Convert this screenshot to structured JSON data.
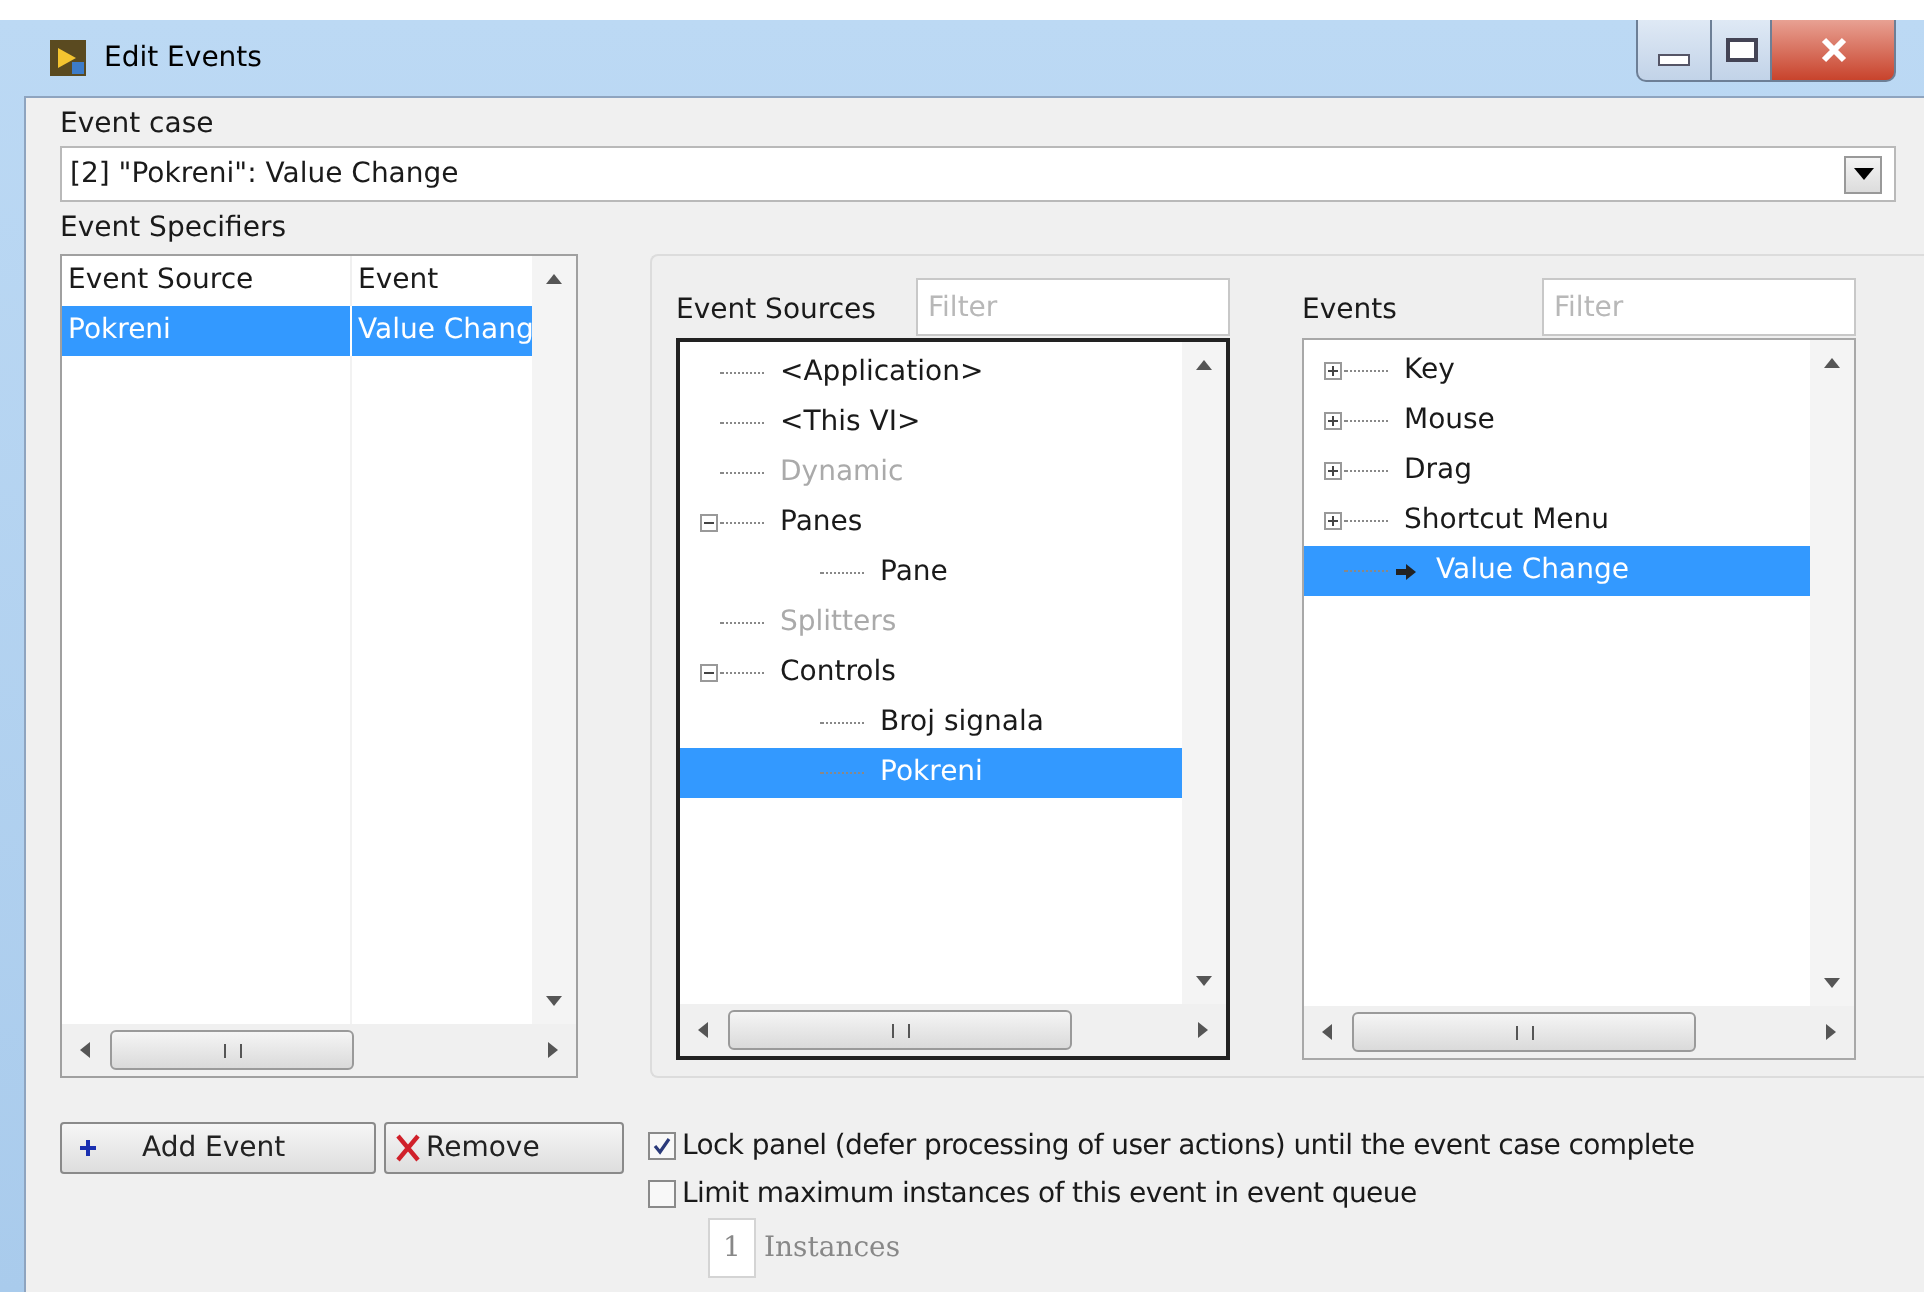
{
  "window": {
    "title": "Edit Events"
  },
  "event_case": {
    "label": "Event case",
    "value": "[2] \"Pokreni\": Value Change"
  },
  "event_specifiers": {
    "label": "Event Specifiers",
    "columns": [
      "Event Source",
      "Event"
    ],
    "rows": [
      {
        "cells": [
          "Pokreni",
          "Value Chang"
        ],
        "selected": true
      }
    ]
  },
  "event_sources": {
    "label": "Event Sources",
    "filter_placeholder": "Filter",
    "items": [
      {
        "label": "<Application>",
        "disabled": false,
        "selected": false
      },
      {
        "label": "<This VI>",
        "disabled": false,
        "selected": false
      },
      {
        "label": "Dynamic",
        "disabled": true,
        "selected": false
      },
      {
        "label": "Panes",
        "disabled": false,
        "selected": false,
        "expanded": true,
        "children": [
          {
            "label": "Pane",
            "disabled": false,
            "selected": false
          }
        ]
      },
      {
        "label": "Splitters",
        "disabled": true,
        "selected": false
      },
      {
        "label": "Controls",
        "disabled": false,
        "selected": false,
        "expanded": true,
        "children": [
          {
            "label": "Broj signala",
            "disabled": false,
            "selected": false
          },
          {
            "label": "Pokreni",
            "disabled": false,
            "selected": true
          }
        ]
      }
    ]
  },
  "events": {
    "label": "Events",
    "filter_placeholder": "Filter",
    "items": [
      {
        "label": "Key",
        "disabled": false,
        "selected": false,
        "expanded": false
      },
      {
        "label": "Mouse",
        "disabled": false,
        "selected": false,
        "expanded": false
      },
      {
        "label": "Drag",
        "disabled": false,
        "selected": false,
        "expanded": false
      },
      {
        "label": "Shortcut Menu",
        "disabled": false,
        "selected": false,
        "expanded": false
      },
      {
        "label": "Value Change",
        "disabled": false,
        "selected": true,
        "kind": "event"
      }
    ]
  },
  "buttons": [
    {
      "label": "Add Event",
      "kind": "add"
    },
    {
      "label": "Remove",
      "kind": "remove"
    }
  ],
  "options": [
    {
      "label": "Lock panel (defer processing of user actions) until the event case complete",
      "checked": true
    },
    {
      "label": "Limit maximum instances of this event in event queue",
      "checked": false
    }
  ],
  "instances": {
    "value": "1",
    "label": "Instances",
    "disabled": true
  }
}
